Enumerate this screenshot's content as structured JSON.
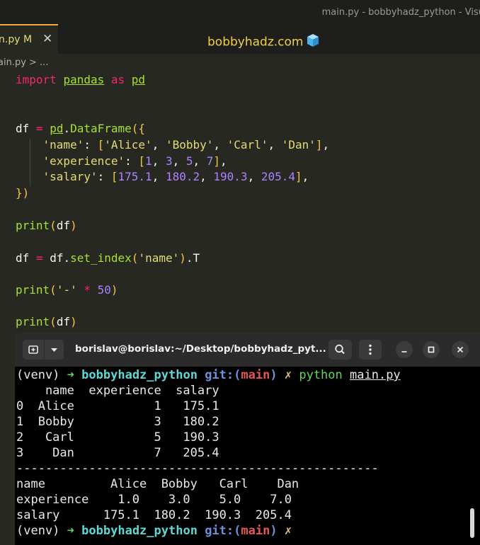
{
  "window": {
    "title": "main.py - bobbyhadz_python - Visu"
  },
  "tab": {
    "label": "n.py M",
    "close": "✕"
  },
  "brand": {
    "text": "bobbyhadz.com",
    "cube": "🧊"
  },
  "breadcrumb": {
    "text": "ain.py > ..."
  },
  "code": {
    "l1": {
      "kw": "import",
      "mod": "pandas",
      "as": "as",
      "alias": "pd"
    },
    "l4": {
      "var": "df",
      "eq": "=",
      "mod": "pd",
      "dot": ".",
      "cls": "DataFrame",
      "open": "({"
    },
    "l5": {
      "key": "'name'",
      "colon": ":",
      "v0": "'Alice'",
      "v1": "'Bobby'",
      "v2": "'Carl'",
      "v3": "'Dan'"
    },
    "l6": {
      "key": "'experience'",
      "colon": ":",
      "v0": "1",
      "v1": "3",
      "v2": "5",
      "v3": "7"
    },
    "l7": {
      "key": "'salary'",
      "colon": ":",
      "v0": "175.1",
      "v1": "180.2",
      "v2": "190.3",
      "v3": "205.4"
    },
    "l8": {
      "close": "})"
    },
    "l10": {
      "fn": "print",
      "arg": "df"
    },
    "l12": {
      "var": "df",
      "eq": "=",
      "obj": "df",
      "meth": "set_index",
      "arg": "'name'",
      "attr": "T"
    },
    "l14": {
      "fn": "print",
      "arg": "'-'",
      "op": "*",
      "num": "50"
    },
    "l16": {
      "fn": "print",
      "arg": "df"
    }
  },
  "terminal": {
    "title": "borislav@borislav:~/Desktop/bobbyhadz_pyt...",
    "newtab_icon": "⊞",
    "dropdown_icon": "▾",
    "search_icon": "⚲",
    "menu_icon": "⋮",
    "min_icon": "–",
    "max_icon": "□",
    "close_icon": "✕",
    "prompt": {
      "venv": "(venv)",
      "arrow": "➜",
      "dir": "bobbyhadz_python",
      "git": "git:",
      "paren_open": "(",
      "branch": "main",
      "paren_close": ")",
      "x": "✗",
      "cmd": "python",
      "file": "main.py"
    },
    "output": [
      "    name  experience  salary",
      "0  Alice           1   175.1",
      "1  Bobby           3   180.2",
      "2   Carl           5   190.3",
      "3    Dan           7   205.4",
      "--------------------------------------------------",
      "name         Alice  Bobby   Carl    Dan",
      "experience    1.0    3.0    5.0    7.0",
      "salary      175.1  180.2  190.3  205.4"
    ]
  }
}
